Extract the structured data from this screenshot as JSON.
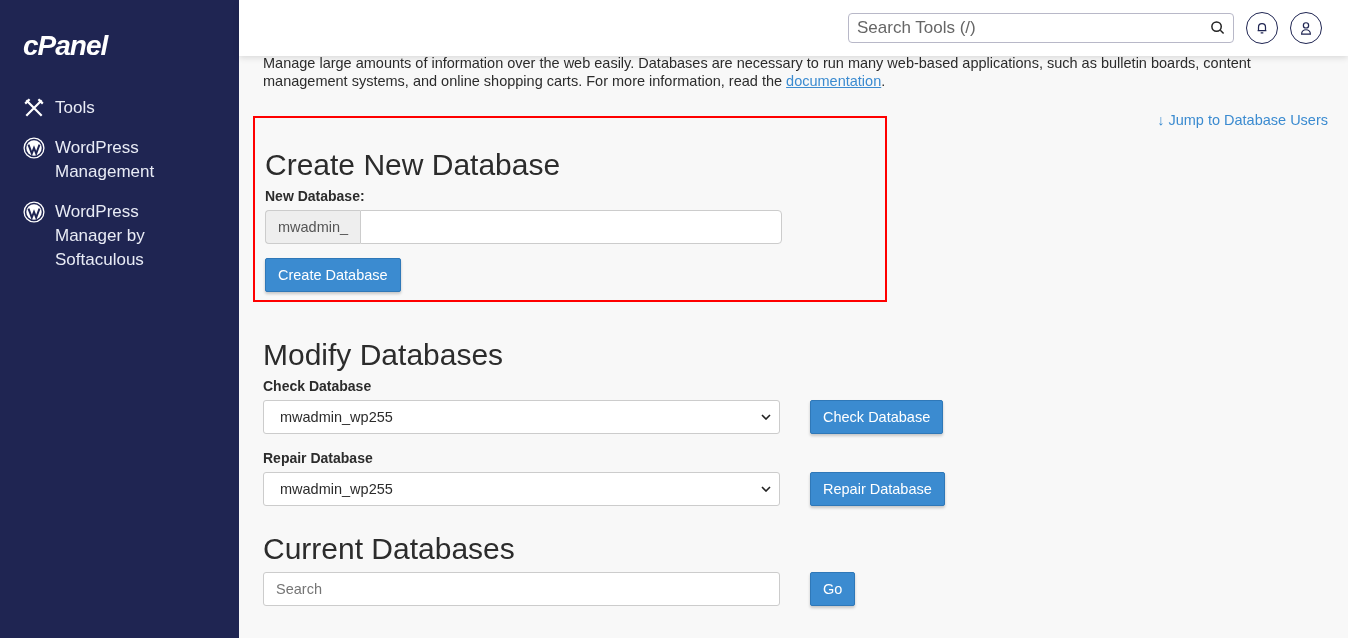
{
  "sidebar": {
    "logo": "cPanel",
    "items": [
      {
        "label": "Tools",
        "kind": "tools"
      },
      {
        "label": "WordPress Management",
        "kind": "wordpress"
      },
      {
        "label": "WordPress Manager by Softaculous",
        "kind": "wordpress"
      }
    ]
  },
  "header": {
    "search": {
      "placeholder": "Search Tools (/)"
    }
  },
  "intro": {
    "text": "Manage large amounts of information over the web easily. Databases are necessary to run many web-based applications, such as bulletin boards, content management systems, and online shopping carts. For more information, read the",
    "link": "documentation",
    "end": "."
  },
  "jump_link": "↓ Jump to Database Users",
  "create": {
    "title": "Create New Database",
    "label": "New Database:",
    "prefix": "mwadmin_",
    "button": "Create Database",
    "highlighted": true
  },
  "modify": {
    "title": "Modify Databases",
    "rows": [
      {
        "label": "Check Database",
        "value": "mwadmin_wp255",
        "button": "Check Database"
      },
      {
        "label": "Repair Database",
        "value": "mwadmin_wp255",
        "button": "Repair Database"
      }
    ]
  },
  "current": {
    "title": "Current Databases",
    "search": {
      "placeholder": "Search"
    },
    "button": "Go"
  }
}
